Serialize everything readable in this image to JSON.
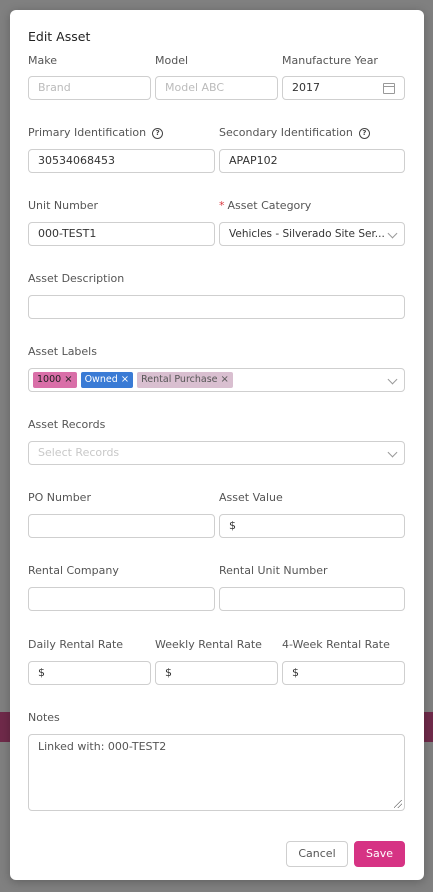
{
  "modal": {
    "title": "Edit Asset"
  },
  "fields": {
    "make": {
      "label": "Make",
      "value": "Brand"
    },
    "model": {
      "label": "Model",
      "value": "Model ABC"
    },
    "manufacture_year": {
      "label": "Manufacture Year",
      "value": "2017"
    },
    "primary_id": {
      "label": "Primary Identification",
      "value": "30534068453"
    },
    "secondary_id": {
      "label": "Secondary Identification",
      "value": "APAP102"
    },
    "unit_number": {
      "label": "Unit Number",
      "value": "000-TEST1"
    },
    "asset_category": {
      "label": "Asset Category",
      "value": "Vehicles - Silverado Site Ser..."
    },
    "asset_description": {
      "label": "Asset Description",
      "value": ""
    },
    "asset_labels": {
      "label": "Asset Labels",
      "tags": [
        {
          "text": "1000",
          "color": "#d96fa8"
        },
        {
          "text": "Owned",
          "color": "#3a7bd5"
        },
        {
          "text": "Rental Purchase",
          "color": "#d9bfd0"
        }
      ]
    },
    "asset_records": {
      "label": "Asset Records",
      "placeholder": "Select Records"
    },
    "po_number": {
      "label": "PO Number",
      "value": ""
    },
    "asset_value": {
      "label": "Asset Value",
      "value": "$"
    },
    "rental_company": {
      "label": "Rental Company",
      "value": ""
    },
    "rental_unit_number": {
      "label": "Rental Unit Number",
      "value": ""
    },
    "daily_rate": {
      "label": "Daily Rental Rate",
      "value": "$"
    },
    "weekly_rate": {
      "label": "Weekly Rental Rate",
      "value": "$"
    },
    "four_week_rate": {
      "label": "4-Week Rental Rate",
      "value": "$"
    },
    "notes": {
      "label": "Notes",
      "value": "Linked with: 000-TEST2"
    }
  },
  "buttons": {
    "cancel": "Cancel",
    "save": "Save"
  },
  "colors": {
    "accent": "#d63384",
    "required": "#d9363e"
  }
}
